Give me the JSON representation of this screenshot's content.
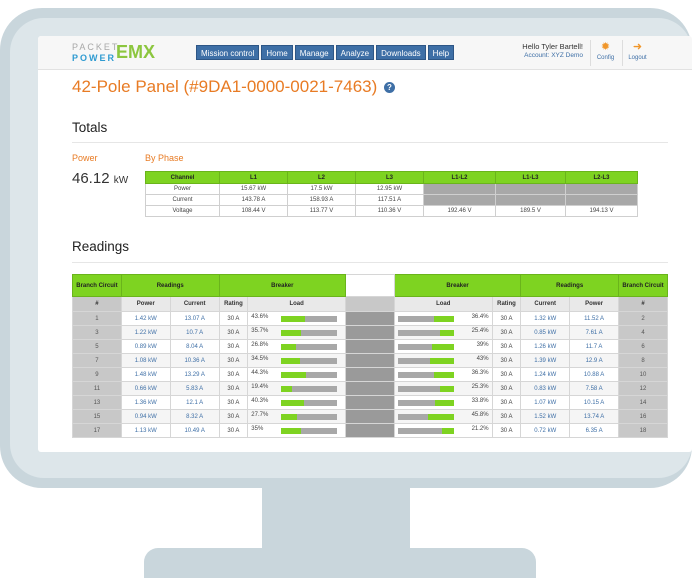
{
  "header": {
    "logo_top": "PACKET",
    "logo_bottom": "POWER",
    "logo_emx": "EMX",
    "nav": [
      "Mission control",
      "Home",
      "Manage",
      "Analyze",
      "Downloads",
      "Help"
    ],
    "user_greeting": "Hello Tyler Bartell!",
    "user_account": "Account: XYZ Demo",
    "config_label": "Config",
    "logout_label": "Logout"
  },
  "page": {
    "title": "42-Pole Panel (#9DA1-0000-0021-7463)",
    "help_glyph": "?"
  },
  "totals": {
    "heading": "Totals",
    "power_label": "Power",
    "power_value": "46.12",
    "power_unit": "kW",
    "phase_label": "By Phase",
    "columns": [
      "Channel",
      "L1",
      "L2",
      "L3",
      "L1-L2",
      "L1-L3",
      "L2-L3"
    ],
    "rows": [
      {
        "label": "Power",
        "values": [
          "15.67 kW",
          "17.5 kW",
          "12.95 kW",
          "",
          "",
          ""
        ]
      },
      {
        "label": "Current",
        "values": [
          "143.78 A",
          "158.93 A",
          "117.51 A",
          "",
          "",
          ""
        ]
      },
      {
        "label": "Voltage",
        "values": [
          "108.44 V",
          "113.77 V",
          "110.36 V",
          "192.46 V",
          "189.5 V",
          "194.13 V"
        ]
      }
    ]
  },
  "readings": {
    "heading": "Readings",
    "group_headers": {
      "branch_left": "Branch Circuit",
      "readings_left": "Readings",
      "breaker_left": "Breaker",
      "breaker_right": "Breaker",
      "readings_right": "Readings",
      "branch_right": "Branch Circuit"
    },
    "sub_headers": {
      "num": "#",
      "power": "Power",
      "current": "Current",
      "rating": "Rating",
      "load": "Load"
    },
    "rows": [
      {
        "left_num": "1",
        "left_power": "1.42 kW",
        "left_current": "13.07 A",
        "left_rating": "30 A",
        "left_load": "43.6%",
        "left_load_value": 0.436,
        "right_load": "36.4%",
        "right_load_value": 0.364,
        "right_rating": "30 A",
        "right_current": "1.32 kW",
        "right_power": "11.52 A",
        "right_num": "2"
      },
      {
        "left_num": "3",
        "left_power": "1.22 kW",
        "left_current": "10.7 A",
        "left_rating": "30 A",
        "left_load": "35.7%",
        "left_load_value": 0.357,
        "right_load": "25.4%",
        "right_load_value": 0.254,
        "right_rating": "30 A",
        "right_current": "0.85 kW",
        "right_power": "7.61 A",
        "right_num": "4"
      },
      {
        "left_num": "5",
        "left_power": "0.89 kW",
        "left_current": "8.04 A",
        "left_rating": "30 A",
        "left_load": "26.8%",
        "left_load_value": 0.268,
        "right_load": "39%",
        "right_load_value": 0.39,
        "right_rating": "30 A",
        "right_current": "1.26 kW",
        "right_power": "11.7 A",
        "right_num": "6"
      },
      {
        "left_num": "7",
        "left_power": "1.08 kW",
        "left_current": "10.36 A",
        "left_rating": "30 A",
        "left_load": "34.5%",
        "left_load_value": 0.345,
        "right_load": "43%",
        "right_load_value": 0.43,
        "right_rating": "30 A",
        "right_current": "1.39 kW",
        "right_power": "12.9 A",
        "right_num": "8"
      },
      {
        "left_num": "9",
        "left_power": "1.48 kW",
        "left_current": "13.29 A",
        "left_rating": "30 A",
        "left_load": "44.3%",
        "left_load_value": 0.443,
        "right_load": "36.3%",
        "right_load_value": 0.363,
        "right_rating": "30 A",
        "right_current": "1.24 kW",
        "right_power": "10.88 A",
        "right_num": "10"
      },
      {
        "left_num": "11",
        "left_power": "0.66 kW",
        "left_current": "5.83 A",
        "left_rating": "30 A",
        "left_load": "19.4%",
        "left_load_value": 0.194,
        "right_load": "25.3%",
        "right_load_value": 0.253,
        "right_rating": "30 A",
        "right_current": "0.83 kW",
        "right_power": "7.58 A",
        "right_num": "12"
      },
      {
        "left_num": "13",
        "left_power": "1.36 kW",
        "left_current": "12.1 A",
        "left_rating": "30 A",
        "left_load": "40.3%",
        "left_load_value": 0.403,
        "right_load": "33.8%",
        "right_load_value": 0.338,
        "right_rating": "30 A",
        "right_current": "1.07 kW",
        "right_power": "10.15 A",
        "right_num": "14"
      },
      {
        "left_num": "15",
        "left_power": "0.94 kW",
        "left_current": "8.32 A",
        "left_rating": "30 A",
        "left_load": "27.7%",
        "left_load_value": 0.277,
        "right_load": "45.8%",
        "right_load_value": 0.458,
        "right_rating": "30 A",
        "right_current": "1.52 kW",
        "right_power": "13.74 A",
        "right_num": "16"
      },
      {
        "left_num": "17",
        "left_power": "1.13 kW",
        "left_current": "10.49 A",
        "left_rating": "30 A",
        "left_load": "35%",
        "left_load_value": 0.35,
        "right_load": "21.2%",
        "right_load_value": 0.212,
        "right_rating": "30 A",
        "right_current": "0.72 kW",
        "right_power": "6.35 A",
        "right_num": "18"
      }
    ]
  },
  "colors": {
    "accent_orange": "#e87b24",
    "nav_blue": "#3e6fa6",
    "table_green": "#7ed321",
    "monitor_gray": "#c9d6dc"
  }
}
